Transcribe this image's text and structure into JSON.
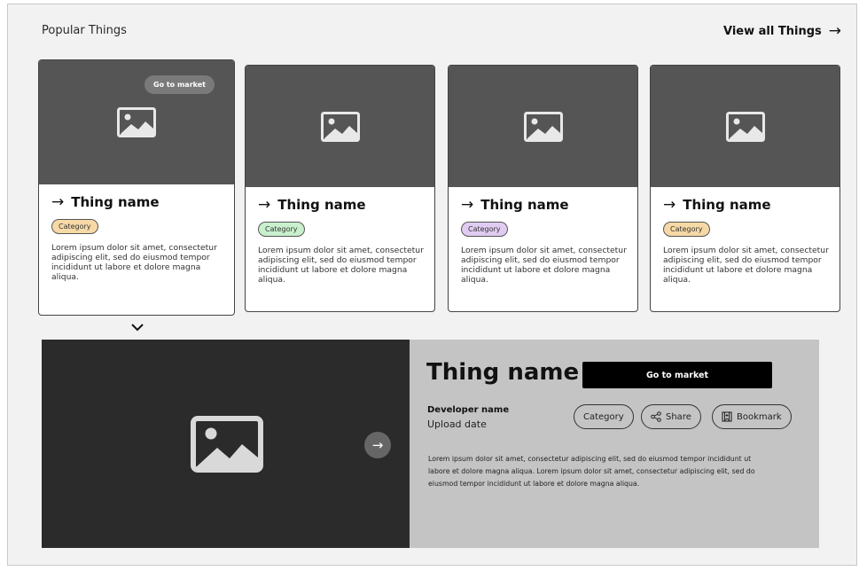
{
  "section": {
    "title": "Popular Things",
    "view_all": "View all Things"
  },
  "cards": [
    {
      "name": "Thing name",
      "category": "Category",
      "category_color": "#f7d9a6",
      "description": "Lorem ipsum dolor sit amet, consectetur adipiscing elit, sed do eiusmod tempor incididunt ut labore et dolore magna aliqua.",
      "hover_button": "Go to market"
    },
    {
      "name": "Thing name",
      "category": "Category",
      "category_color": "#c8f0cc",
      "description": "Lorem ipsum dolor sit amet, consectetur adipiscing elit, sed do eiusmod tempor incididunt ut labore et dolore magna aliqua."
    },
    {
      "name": "Thing name",
      "category": "Category",
      "category_color": "#e0ccf2",
      "description": "Lorem ipsum dolor sit amet, consectetur adipiscing elit, sed do eiusmod tempor incididunt ut labore et dolore magna aliqua."
    },
    {
      "name": "Thing name",
      "category": "Category",
      "category_color": "#f7d9a6",
      "description": "Lorem ipsum dolor sit amet, consectetur adipiscing elit, sed do eiusmod tempor incididunt ut labore et dolore magna aliqua."
    }
  ],
  "detail": {
    "title": "Thing name",
    "go_to_market": "Go to market",
    "developer": "Developer name",
    "upload_date": "Upload date",
    "category": "Category",
    "share": "Share",
    "bookmark": "Bookmark",
    "description": "Lorem ipsum dolor sit amet, consectetur adipiscing elit, sed do eiusmod tempor incididunt ut labore et dolore magna aliqua. Lorem ipsum dolor sit amet, consectetur adipiscing elit, sed do eiusmod tempor incididunt ut labore et dolore magna aliqua."
  },
  "icons": {
    "card_image": "image-placeholder-icon",
    "arrow": "arrow-right-icon",
    "expand": "chevron-down-icon",
    "next": "next-arrow-icon",
    "share": "share-icon",
    "bookmark": "bookmark-icon"
  },
  "colors": {
    "card_media": "#555555",
    "gallery_bg": "#2b2b2b",
    "detail_bg": "#c4c4c4",
    "primary_button": "#000000"
  }
}
